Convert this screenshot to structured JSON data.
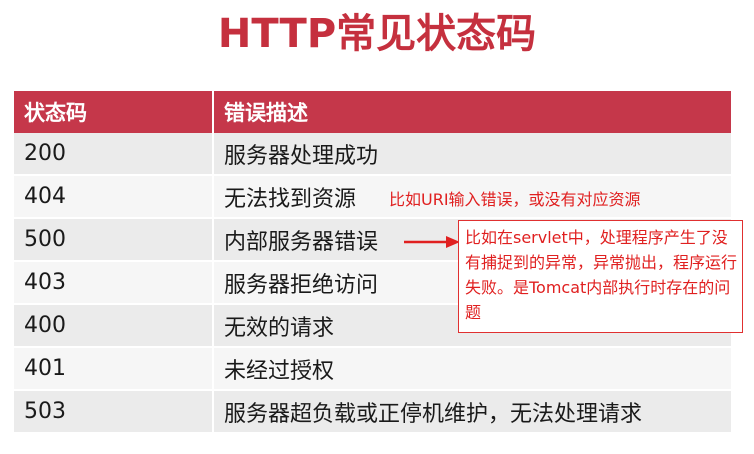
{
  "title": "HTTP常见状态码",
  "table": {
    "headers": [
      "状态码",
      "错误描述"
    ],
    "rows": [
      {
        "code": "200",
        "desc": "服务器处理成功"
      },
      {
        "code": "404",
        "desc": "无法找到资源"
      },
      {
        "code": "500",
        "desc": "内部服务器错误"
      },
      {
        "code": "403",
        "desc": "服务器拒绝访问"
      },
      {
        "code": "400",
        "desc": "无效的请求"
      },
      {
        "code": "401",
        "desc": "未经过授权"
      },
      {
        "code": "503",
        "desc": "服务器超负载或正停机维护，无法处理请求"
      }
    ]
  },
  "annotations": {
    "note_404": "比如URI输入错误，或没有对应资源",
    "note_500": "比如在servlet中，处理程序产生了没有捕捉到的异常，异常抛出，程序运行失败。是Tomcat内部执行时存在的问题"
  },
  "colors": {
    "title": "#c5303e",
    "header_bg": "#c5374a",
    "annotation": "#e02020"
  }
}
